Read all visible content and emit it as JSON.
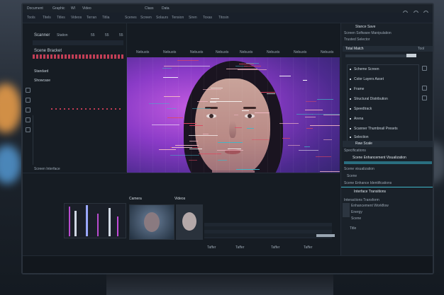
{
  "menu": {
    "items": [
      "Document",
      "Graphic",
      "Wl",
      "Video",
      "Class",
      "Data"
    ]
  },
  "toolbar": {
    "items": [
      "Tools",
      "Titels",
      "Titles",
      "Videos",
      "Terran",
      "Titlia",
      "Scenes",
      "Screen",
      "Solaurs",
      "Tension",
      "Siren",
      "Toxas",
      "Titosin"
    ]
  },
  "left_panel": {
    "title": "Scanner",
    "subtitle": "Station",
    "numbers": [
      "55",
      "55",
      "55"
    ],
    "header_label": "Scene Bracket",
    "section_a": "Standard",
    "section_b": "Showcase",
    "footer_label": "Screen Interface",
    "footer_sub": "Scan Statistics Manager"
  },
  "timeline_labels": [
    "Nebusts",
    "Nebusts",
    "Nebusts",
    "Nebusts",
    "Nebusts",
    "Nebusts",
    "Nebusts",
    "Nebusts"
  ],
  "right_panel": {
    "header": "Stance Save",
    "sub1": "Screen Software Manipulation",
    "sub2": "Trusted Selector",
    "section_title": "Total Match",
    "section_value": "Tool",
    "items": [
      "Scheme Screen",
      "Color Layers Asset",
      "Frame",
      "Structural Distribution",
      "Speedtrack",
      "Arena",
      "Scanner Thumbnail Presets",
      "Selection"
    ],
    "section2": "Raw Scale",
    "section2_sub": "Specifications",
    "scan_label": "Scene Enhancement Visualization",
    "scan_sub": "Scene visualization",
    "layer_label": "Scene",
    "layer_sub": "Scene Enhance Identifications",
    "layer2": "Interface Transitions",
    "detail_title": "Interactions Transform",
    "detail_lines": [
      "Enhancement Workflow",
      "Energy",
      "Scene"
    ],
    "detail_footer": "Title"
  },
  "bottom_panel": {
    "label_a": "Camera",
    "label_b": "Videos",
    "footer_values": [
      "Taffer",
      "Taffer",
      "Taffer",
      "Taffer"
    ]
  },
  "colors": {
    "accent_red": "#e0455f",
    "accent_teal": "#3fb6c8",
    "accent_magenta": "#c24ad8"
  }
}
